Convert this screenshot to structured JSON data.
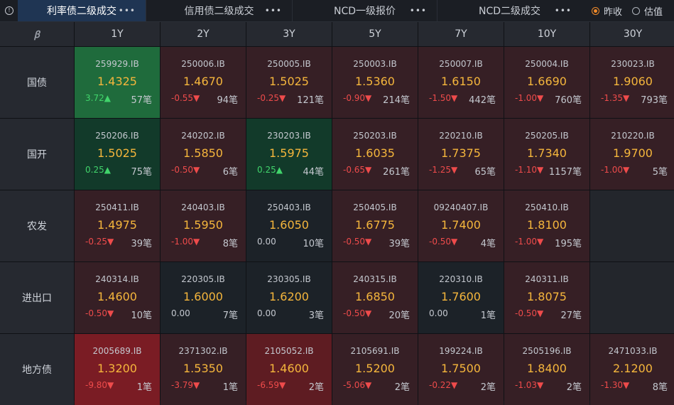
{
  "tabs": [
    {
      "label": "利率债二级成交",
      "active": true
    },
    {
      "label": "信用债二级成交",
      "active": false
    },
    {
      "label": "NCD一级报价",
      "active": false
    },
    {
      "label": "NCD二级成交",
      "active": false
    }
  ],
  "tab_menu": "•••",
  "radio_options": [
    {
      "label": "昨收",
      "selected": true
    },
    {
      "label": "估值",
      "selected": false
    }
  ],
  "corner_icon": "ꞵ",
  "columns": [
    "1Y",
    "2Y",
    "3Y",
    "5Y",
    "7Y",
    "10Y",
    "30Y"
  ],
  "rows": [
    {
      "label": "国债",
      "cells": [
        {
          "code": "259929.IB",
          "price": "1.4325",
          "change": "3.72▲",
          "count": "57笔",
          "dir": "up",
          "tone": "green-strong"
        },
        {
          "code": "250006.IB",
          "price": "1.4670",
          "change": "-0.55▼",
          "count": "94笔",
          "dir": "down",
          "tone": "red"
        },
        {
          "code": "250005.IB",
          "price": "1.5025",
          "change": "-0.25▼",
          "count": "121笔",
          "dir": "down",
          "tone": "red"
        },
        {
          "code": "250003.IB",
          "price": "1.5360",
          "change": "-0.90▼",
          "count": "214笔",
          "dir": "down",
          "tone": "red"
        },
        {
          "code": "250007.IB",
          "price": "1.6150",
          "change": "-1.50▼",
          "count": "442笔",
          "dir": "down",
          "tone": "red"
        },
        {
          "code": "250004.IB",
          "price": "1.6690",
          "change": "-1.00▼",
          "count": "760笔",
          "dir": "down",
          "tone": "red"
        },
        {
          "code": "230023.IB",
          "price": "1.9060",
          "change": "-1.35▼",
          "count": "793笔",
          "dir": "down",
          "tone": "red"
        }
      ]
    },
    {
      "label": "国开",
      "cells": [
        {
          "code": "250206.IB",
          "price": "1.5025",
          "change": "0.25▲",
          "count": "75笔",
          "dir": "up",
          "tone": "green"
        },
        {
          "code": "240202.IB",
          "price": "1.5850",
          "change": "-0.50▼",
          "count": "6笔",
          "dir": "down",
          "tone": "red"
        },
        {
          "code": "230203.IB",
          "price": "1.5975",
          "change": "0.25▲",
          "count": "44笔",
          "dir": "up",
          "tone": "green"
        },
        {
          "code": "250203.IB",
          "price": "1.6035",
          "change": "-0.65▼",
          "count": "261笔",
          "dir": "down",
          "tone": "red"
        },
        {
          "code": "220210.IB",
          "price": "1.7375",
          "change": "-1.25▼",
          "count": "65笔",
          "dir": "down",
          "tone": "red"
        },
        {
          "code": "250205.IB",
          "price": "1.7340",
          "change": "-1.10▼",
          "count": "1157笔",
          "dir": "down",
          "tone": "red"
        },
        {
          "code": "210220.IB",
          "price": "1.9700",
          "change": "-1.00▼",
          "count": "5笔",
          "dir": "down",
          "tone": "red"
        }
      ]
    },
    {
      "label": "农发",
      "cells": [
        {
          "code": "250411.IB",
          "price": "1.4975",
          "change": "-0.25▼",
          "count": "39笔",
          "dir": "down",
          "tone": "red"
        },
        {
          "code": "240403.IB",
          "price": "1.5950",
          "change": "-1.00▼",
          "count": "8笔",
          "dir": "down",
          "tone": "red"
        },
        {
          "code": "250403.IB",
          "price": "1.6050",
          "change": "0.00",
          "count": "10笔",
          "dir": "flat",
          "tone": "neutral"
        },
        {
          "code": "250405.IB",
          "price": "1.6775",
          "change": "-0.50▼",
          "count": "39笔",
          "dir": "down",
          "tone": "red"
        },
        {
          "code": "09240407.IB",
          "price": "1.7400",
          "change": "-0.50▼",
          "count": "4笔",
          "dir": "down",
          "tone": "red"
        },
        {
          "code": "250410.IB",
          "price": "1.8100",
          "change": "-1.00▼",
          "count": "195笔",
          "dir": "down",
          "tone": "red"
        },
        null
      ]
    },
    {
      "label": "进出口",
      "cells": [
        {
          "code": "240314.IB",
          "price": "1.4600",
          "change": "-0.50▼",
          "count": "10笔",
          "dir": "down",
          "tone": "red"
        },
        {
          "code": "220305.IB",
          "price": "1.6000",
          "change": "0.00",
          "count": "7笔",
          "dir": "flat",
          "tone": "neutral"
        },
        {
          "code": "230305.IB",
          "price": "1.6200",
          "change": "0.00",
          "count": "3笔",
          "dir": "flat",
          "tone": "neutral"
        },
        {
          "code": "240315.IB",
          "price": "1.6850",
          "change": "-0.50▼",
          "count": "20笔",
          "dir": "down",
          "tone": "red"
        },
        {
          "code": "220310.IB",
          "price": "1.7600",
          "change": "0.00",
          "count": "1笔",
          "dir": "flat",
          "tone": "neutral"
        },
        {
          "code": "240311.IB",
          "price": "1.8075",
          "change": "-0.50▼",
          "count": "27笔",
          "dir": "down",
          "tone": "red"
        },
        null
      ]
    },
    {
      "label": "地方债",
      "cells": [
        {
          "code": "2005689.IB",
          "price": "1.3200",
          "change": "-9.80▼",
          "count": "1笔",
          "dir": "down",
          "tone": "red-strong"
        },
        {
          "code": "2371302.IB",
          "price": "1.5350",
          "change": "-3.79▼",
          "count": "1笔",
          "dir": "down",
          "tone": "red"
        },
        {
          "code": "2105052.IB",
          "price": "1.4600",
          "change": "-6.59▼",
          "count": "2笔",
          "dir": "down",
          "tone": "red-mid"
        },
        {
          "code": "2105691.IB",
          "price": "1.5200",
          "change": "-5.06▼",
          "count": "2笔",
          "dir": "down",
          "tone": "red"
        },
        {
          "code": "199224.IB",
          "price": "1.7500",
          "change": "-0.22▼",
          "count": "2笔",
          "dir": "down",
          "tone": "red"
        },
        {
          "code": "2505196.IB",
          "price": "1.8400",
          "change": "-1.03▼",
          "count": "2笔",
          "dir": "down",
          "tone": "red"
        },
        {
          "code": "2471033.IB",
          "price": "2.1200",
          "change": "-1.30▼",
          "count": "8笔",
          "dir": "down",
          "tone": "red"
        }
      ]
    }
  ]
}
